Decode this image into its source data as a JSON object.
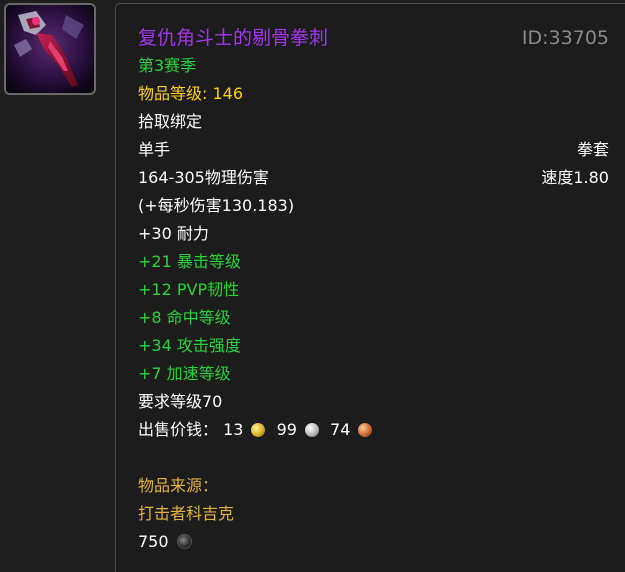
{
  "item": {
    "name": "复仇角斗士的剔骨拳刺",
    "id_label": "ID:33705",
    "season": "第3赛季",
    "item_level_label": "物品等级:",
    "item_level_value": "146",
    "binding": "拾取绑定",
    "slot": "单手",
    "weapon_type": "拳套",
    "damage": "164-305物理伤害",
    "speed": "速度1.80",
    "dps": "(+每秒伤害130.183)",
    "base_stat": "+30 耐力",
    "bonus_stats": [
      "+21 暴击等级",
      "+12 PVP韧性",
      "+8 命中等级",
      "+34 攻击强度",
      "+7 加速等级"
    ],
    "required_level": "要求等级70",
    "sell_price": {
      "label": "出售价钱：",
      "gold": "13",
      "silver": "99",
      "copper": "74"
    },
    "source": {
      "label": "物品来源：",
      "npc": "打击者科吉克",
      "cost": "750"
    },
    "icon_name": "fist-weapon-icon",
    "colors": {
      "epic": "#a335ee",
      "stat_green": "#1eff00",
      "item_level": "#ffd100",
      "source_gold": "#e6b23a",
      "id_gray": "#8a8a8a"
    }
  }
}
